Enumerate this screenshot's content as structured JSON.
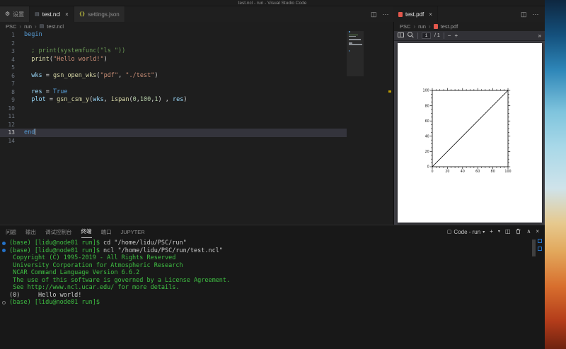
{
  "window": {
    "title": "test.ncl - run - Visual Studio Code"
  },
  "glyphs": {
    "close": "×",
    "more": "⋯",
    "split": "◫",
    "chevron_down": "▾",
    "chevron_up": "∧",
    "plus": "+",
    "chevrons_right": "»",
    "task": "▢",
    "crumb_sep": "›"
  },
  "editor_group": {
    "tabs": [
      {
        "id": "settings",
        "label": "设置",
        "icon": "gear",
        "active": false,
        "close": ""
      },
      {
        "id": "test-ncl",
        "label": "test.ncl",
        "icon": "file",
        "active": true,
        "close": "×"
      },
      {
        "id": "settings-json",
        "label": "settings.json",
        "icon": "json",
        "active": false,
        "close": ""
      }
    ],
    "breadcrumb": [
      {
        "id": "psc",
        "label": "PSC"
      },
      {
        "id": "run",
        "label": "run"
      },
      {
        "id": "test-ncl",
        "label": "test.ncl",
        "icon": "file"
      }
    ],
    "code": {
      "lines": [
        {
          "num": 1,
          "segments": [
            [
              "keyword",
              "begin"
            ]
          ]
        },
        {
          "num": 2,
          "segments": []
        },
        {
          "num": 3,
          "segments": [
            [
              "comment",
              "  ; print(systemfunc(\"ls \"))"
            ]
          ]
        },
        {
          "num": 4,
          "segments": [
            [
              "default",
              "  "
            ],
            [
              "function",
              "print"
            ],
            [
              "default",
              "("
            ],
            [
              "string",
              "\"Hello world!\""
            ],
            [
              "default",
              ")"
            ]
          ]
        },
        {
          "num": 5,
          "segments": []
        },
        {
          "num": 6,
          "segments": [
            [
              "default",
              "  "
            ],
            [
              "variable",
              "wks"
            ],
            [
              "default",
              " = "
            ],
            [
              "function",
              "gsn_open_wks"
            ],
            [
              "default",
              "("
            ],
            [
              "string",
              "\"pdf\""
            ],
            [
              "default",
              ", "
            ],
            [
              "string",
              "\"./test\""
            ],
            [
              "default",
              ")"
            ]
          ]
        },
        {
          "num": 7,
          "segments": []
        },
        {
          "num": 8,
          "segments": [
            [
              "default",
              "  "
            ],
            [
              "variable",
              "res"
            ],
            [
              "default",
              " = "
            ],
            [
              "keyword",
              "True"
            ]
          ]
        },
        {
          "num": 9,
          "segments": [
            [
              "default",
              "  "
            ],
            [
              "variable",
              "plot"
            ],
            [
              "default",
              " = "
            ],
            [
              "function",
              "gsn_csm_y"
            ],
            [
              "default",
              "("
            ],
            [
              "variable",
              "wks"
            ],
            [
              "default",
              ", "
            ],
            [
              "function",
              "ispan"
            ],
            [
              "default",
              "("
            ],
            [
              "number",
              "0"
            ],
            [
              "default",
              ","
            ],
            [
              "number",
              "100"
            ],
            [
              "default",
              ","
            ],
            [
              "number",
              "1"
            ],
            [
              "default",
              ") , "
            ],
            [
              "variable",
              "res"
            ],
            [
              "default",
              ")"
            ]
          ]
        },
        {
          "num": 10,
          "segments": []
        },
        {
          "num": 11,
          "segments": []
        },
        {
          "num": 12,
          "segments": []
        },
        {
          "num": 13,
          "segments": [
            [
              "keyword",
              "end"
            ]
          ],
          "current": true
        },
        {
          "num": 14,
          "segments": []
        }
      ]
    }
  },
  "pdf_group": {
    "tabs": [
      {
        "id": "test-pdf",
        "label": "test.pdf",
        "icon": "pdf",
        "active": true,
        "close": "×"
      }
    ],
    "breadcrumb": [
      {
        "id": "psc",
        "label": "PSC"
      },
      {
        "id": "run",
        "label": "run"
      },
      {
        "id": "test-pdf",
        "label": "test.pdf",
        "icon": "pdf"
      }
    ],
    "toolbar": {
      "page_value": "1",
      "page_total": "/ 1",
      "zoom_out": "−",
      "zoom_in": "+",
      "overflow": "»"
    }
  },
  "panel": {
    "tabs": [
      {
        "id": "problems",
        "label": "问题"
      },
      {
        "id": "output",
        "label": "输出"
      },
      {
        "id": "debug-console",
        "label": "调试控制台"
      },
      {
        "id": "terminal",
        "label": "终端",
        "active": true
      },
      {
        "id": "ports",
        "label": "端口"
      },
      {
        "id": "jupyter",
        "label": "JUPYTER"
      }
    ],
    "terminal": {
      "name": "Code - run",
      "lines": [
        {
          "decoration": "command",
          "segments": [
            [
              "green",
              "(base) [lidu@node01 run]$"
            ],
            [
              "default",
              " cd \"/home/lidu/PSC/run\""
            ]
          ]
        },
        {
          "decoration": "command",
          "segments": [
            [
              "green",
              "(base) [lidu@node01 run]$"
            ],
            [
              "default",
              " ncl \"/home/lidu/PSC/run/test.ncl\""
            ]
          ]
        },
        {
          "segments": [
            [
              "green",
              " Copyright (C) 1995-2019 - All Rights Reserved"
            ]
          ]
        },
        {
          "segments": [
            [
              "green",
              " University Corporation for Atmospheric Research"
            ]
          ]
        },
        {
          "segments": [
            [
              "green",
              " NCAR Command Language Version 6.6.2"
            ]
          ]
        },
        {
          "segments": [
            [
              "green",
              " The use of this software is governed by a License Agreement."
            ]
          ]
        },
        {
          "segments": [
            [
              "green",
              " See http://www.ncl.ucar.edu/ for more details."
            ]
          ]
        },
        {
          "segments": [
            [
              "default",
              "(0)     Hello world!"
            ]
          ]
        },
        {
          "decoration": "prompt",
          "segments": [
            [
              "green",
              "(base) [lidu@node01 run]$ "
            ]
          ]
        }
      ]
    }
  },
  "chart_data": {
    "type": "line",
    "title": "",
    "xlabel": "",
    "ylabel": "",
    "xlim": [
      0,
      100
    ],
    "ylim": [
      0,
      100
    ],
    "xticks": [
      0,
      20,
      40,
      60,
      80,
      100
    ],
    "yticks": [
      0,
      20,
      40,
      60,
      80,
      100
    ],
    "minor_tick_step": 5,
    "grid": false,
    "legend": false,
    "series": [
      {
        "name": "ispan(0,100,1)",
        "color": "#000000",
        "points": [
          [
            0,
            0
          ],
          [
            100,
            100
          ]
        ]
      }
    ]
  }
}
